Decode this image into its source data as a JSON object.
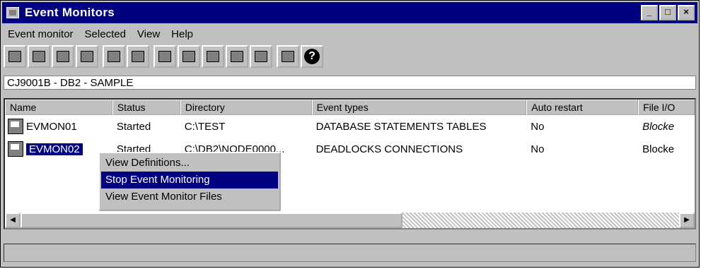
{
  "window": {
    "title": "Event Monitors",
    "controls": [
      "_",
      "□",
      "×"
    ]
  },
  "menubar": [
    "Event monitor",
    "Selected",
    "View",
    "Help"
  ],
  "toolbar": {
    "help_label": "?"
  },
  "breadcrumb": "CJ9001B - DB2 - SAMPLE",
  "columns": [
    "Name",
    "Status",
    "Directory",
    "Event types",
    "Auto restart",
    "File I/O"
  ],
  "rows": [
    {
      "name": "EVMON01",
      "status": "Started",
      "directory": "C:\\TEST",
      "event_types": "DATABASE STATEMENTS TABLES",
      "auto_restart": "No",
      "file_io": "Blocke"
    },
    {
      "name": "EVMON02",
      "status": "Started",
      "directory": "C:\\DB2\\NODE0000...",
      "event_types": "DEADLOCKS CONNECTIONS",
      "auto_restart": "No",
      "file_io": "Blocke"
    }
  ],
  "context_menu": {
    "items": [
      "View Definitions...",
      "Stop Event Monitoring",
      "View Event Monitor Files"
    ],
    "active_index": 1
  },
  "scrollbar": {
    "left_arrow": "◀",
    "right_arrow": "▶"
  }
}
